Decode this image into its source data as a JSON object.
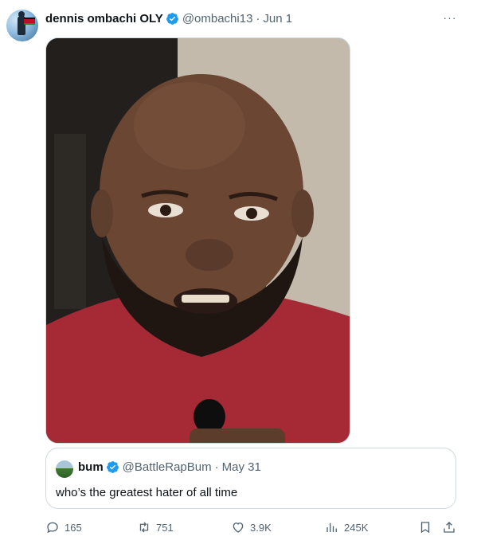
{
  "tweet": {
    "display_name": "dennis ombachi OLY",
    "handle": "@ombachi13",
    "separator": "·",
    "date": "Jun 1",
    "more_label": "···",
    "accent_color": "#1d9bf0"
  },
  "quoted": {
    "display_name": "bum",
    "handle": "@BattleRapBum",
    "separator": "·",
    "date": "May 31",
    "text": "who’s the greatest hater of all time"
  },
  "actions": {
    "replies": "165",
    "retweets": "751",
    "likes": "3.9K",
    "views": "245K"
  },
  "icons": [
    "verified-badge-icon",
    "more-icon",
    "reply-icon",
    "retweet-icon",
    "like-icon",
    "views-icon",
    "bookmark-icon",
    "share-icon"
  ]
}
